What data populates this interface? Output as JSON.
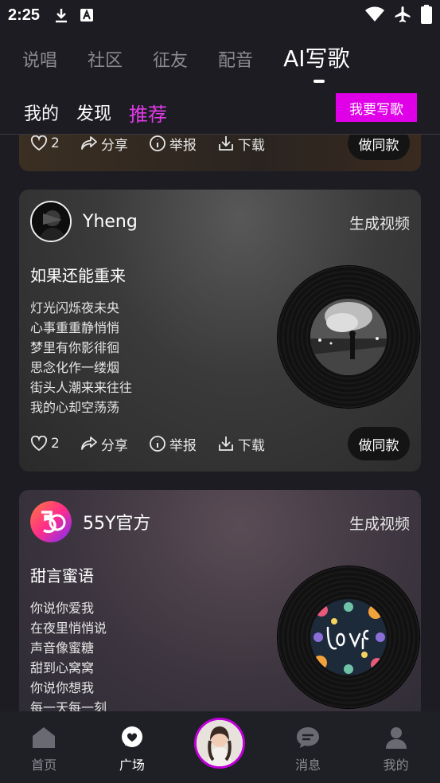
{
  "status": {
    "time": "2:25"
  },
  "top_tabs": [
    "说唱",
    "社区",
    "征友",
    "配音",
    "AI写歌"
  ],
  "sub_tabs": [
    "我的",
    "发现",
    "推荐"
  ],
  "write_button": "我要写歌",
  "top_card_actions": {
    "likes": "2",
    "share": "分享",
    "report": "举报",
    "download": "下载",
    "same": "做同款"
  },
  "cards": [
    {
      "username": "Yheng",
      "gen_video": "生成视频",
      "title": "如果还能重来",
      "lyrics": [
        "灯光闪烁夜未央",
        "心事重重静悄悄",
        "梦里有你影徘徊",
        "思念化作一缕烟",
        "街头人潮来来往往",
        "我的心却空荡荡"
      ],
      "likes": "2",
      "share": "分享",
      "report": "举报",
      "download": "下载",
      "same": "做同款"
    },
    {
      "username": "55Y官方",
      "gen_video": "生成视频",
      "title": "甜言蜜语",
      "lyrics": [
        "你说你爱我",
        "在夜里悄悄说",
        "声音像蜜糖",
        "甜到心窝窝",
        "你说你想我",
        "每一天每一刻"
      ]
    }
  ],
  "bottom_nav": [
    "首页",
    "广场",
    "",
    "消息",
    "我的"
  ],
  "colors": {
    "accent": "#e000e8",
    "active_sub_tab": "#e13be8"
  }
}
